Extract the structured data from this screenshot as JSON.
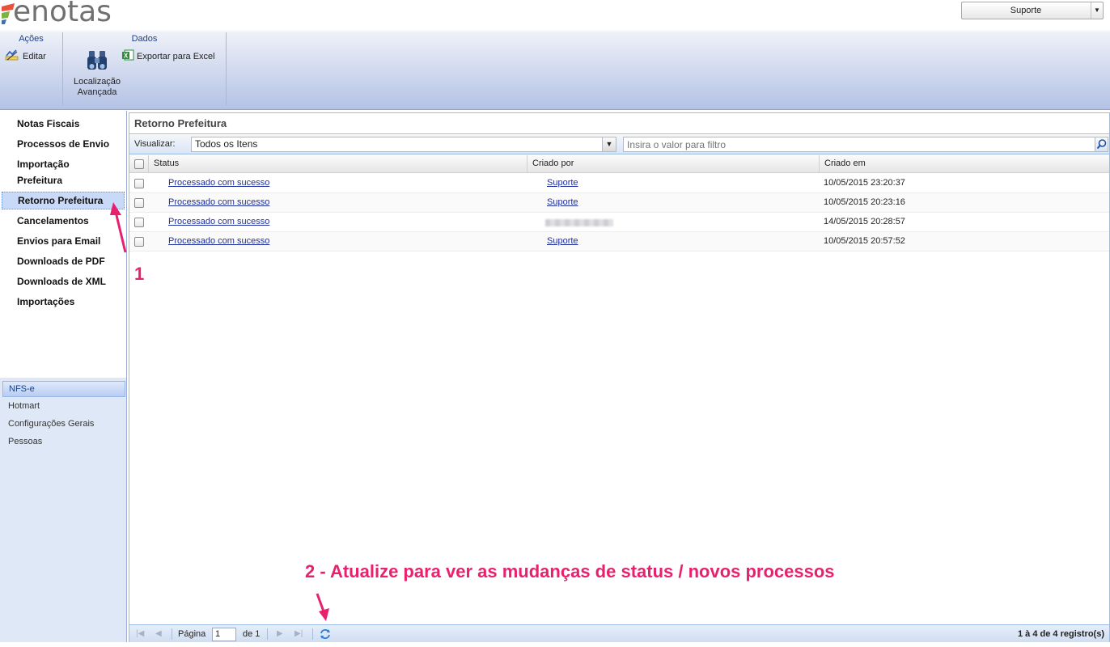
{
  "header": {
    "logo_text": "enotas",
    "user_menu": {
      "label": "Suporte"
    }
  },
  "ribbon": {
    "groups": [
      {
        "title": "Ações",
        "buttons": [
          {
            "label": "Editar",
            "icon": "edit-icon"
          }
        ]
      },
      {
        "title": "Dados",
        "buttons": [
          {
            "label_line1": "Localização",
            "label_line2": "Avançada",
            "icon": "binoculars-icon"
          },
          {
            "label": "Exportar para Excel",
            "icon": "excel-icon"
          }
        ]
      }
    ]
  },
  "sidebar": {
    "items": [
      {
        "label": "Notas Fiscais"
      },
      {
        "label": "Processos de Envio"
      },
      {
        "label_line1": "Importação",
        "label_line2": "Prefeitura"
      },
      {
        "label": "Retorno Prefeitura",
        "active": true
      },
      {
        "label": "Cancelamentos"
      },
      {
        "label": "Envios para Email"
      },
      {
        "label": "Downloads de PDF"
      },
      {
        "label": "Downloads de XML"
      },
      {
        "label": "Importações"
      }
    ],
    "modules": [
      {
        "label": "NFS-e",
        "active": true
      },
      {
        "label": "Hotmart"
      },
      {
        "label": "Configurações Gerais"
      },
      {
        "label": "Pessoas"
      }
    ]
  },
  "main": {
    "title": "Retorno Prefeitura",
    "toolbar": {
      "view_label": "Visualizar:",
      "view_selected": "Todos os Itens",
      "filter_placeholder": "Insira o valor para filtro"
    },
    "grid": {
      "columns": [
        "Status",
        "Criado por",
        "Criado em"
      ],
      "rows": [
        {
          "status": "Processado com sucesso",
          "created_by": "Suporte",
          "created_at": "10/05/2015 23:20:37"
        },
        {
          "status": "Processado com sucesso",
          "created_by": "Suporte",
          "created_at": "10/05/2015 20:23:16"
        },
        {
          "status": "Processado com sucesso",
          "created_by": "",
          "created_at": "14/05/2015 20:28:57",
          "created_by_blurred": true
        },
        {
          "status": "Processado com sucesso",
          "created_by": "Suporte",
          "created_at": "10/05/2015 20:57:52"
        }
      ]
    },
    "paging": {
      "page_label": "Página",
      "page_value": "1",
      "of_label": "de 1",
      "summary": "1 à 4 de 4 registro(s)"
    }
  },
  "annotations": {
    "one": "1",
    "two": "2 - Atualize para ver as mudanças de status / novos processos"
  },
  "colors": {
    "accent": "#e8216e",
    "link": "#1f2f9c",
    "ribbon_title": "#1c3f94"
  }
}
